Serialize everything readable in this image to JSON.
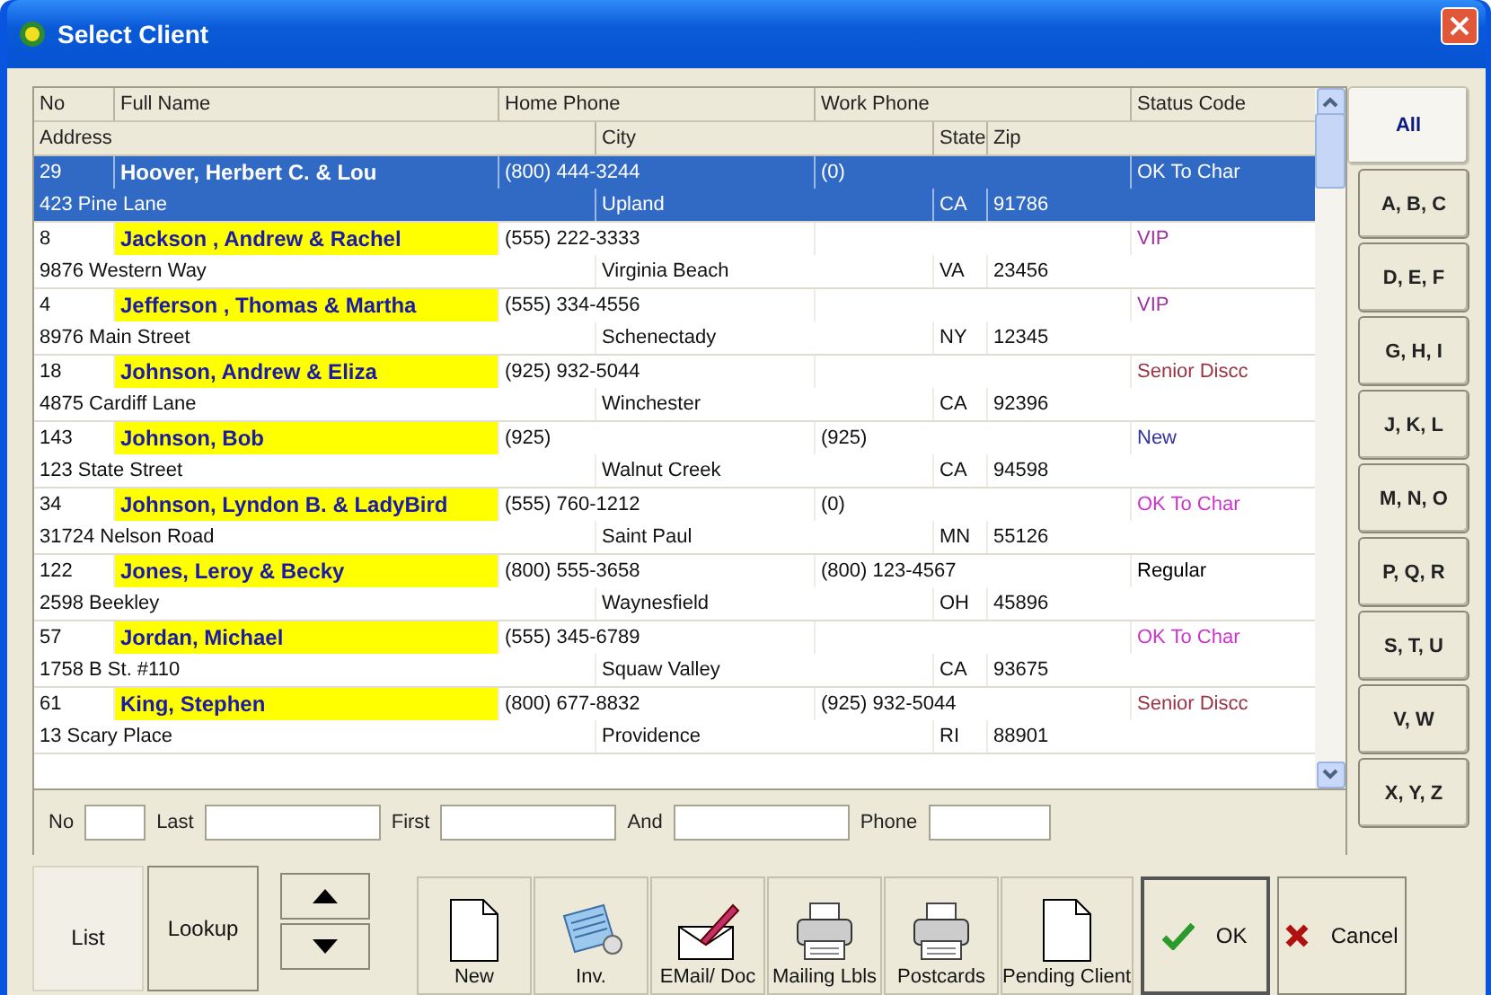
{
  "window": {
    "title": "Select Client"
  },
  "table": {
    "columns_line1": [
      "No",
      "Full Name",
      "Home Phone",
      "Work Phone",
      "Status Code"
    ],
    "columns_line2": [
      "Address",
      "City",
      "State",
      "Zip"
    ],
    "rows": [
      {
        "no": "29",
        "name": "Hoover, Herbert C. & Lou",
        "home_phone": "(800) 444-3244",
        "work_phone": "(0)",
        "status": "OK  To Char",
        "address": "423 Pine Lane",
        "city": "Upland",
        "state": "CA",
        "zip": "91786",
        "selected": true
      },
      {
        "no": "8",
        "name": "Jackson , Andrew & Rachel",
        "home_phone": "(555) 222-3333",
        "status": "VIP",
        "color": "#a030a0",
        "address": "9876 Western Way",
        "city": "Virginia Beach",
        "state": "VA",
        "zip": "23456",
        "selected": false
      },
      {
        "no": "4",
        "name": "Jefferson , Thomas & Martha",
        "home_phone": "(555) 334-4556",
        "status": "VIP",
        "color": "#a030a0",
        "address": "8976 Main Street",
        "city": "Schenectady",
        "state": "NY",
        "zip": "12345",
        "selected": false
      },
      {
        "no": "18",
        "name": "Johnson, Andrew & Eliza",
        "home_phone": "(925) 932-5044",
        "status": "Senior Discc",
        "color": "#993344",
        "address": "4875 Cardiff Lane",
        "city": "Winchester",
        "state": "CA",
        "zip": "92396",
        "selected": false
      },
      {
        "no": "143",
        "name": "Johnson, Bob",
        "home_phone": "(925)",
        "work_phone": "(925)",
        "status": "New",
        "color": "#333399",
        "address": "123 State Street",
        "city": "Walnut Creek",
        "state": "CA",
        "zip": "94598",
        "selected": false
      },
      {
        "no": "34",
        "name": "Johnson, Lyndon B. & LadyBird",
        "home_phone": "(555) 760-1212",
        "work_phone": "(0)",
        "status": "OK  To Char",
        "color": "#cc33cc",
        "address": "31724 Nelson Road",
        "city": "Saint Paul",
        "state": "MN",
        "zip": "55126",
        "selected": false
      },
      {
        "no": "122",
        "name": "Jones, Leroy & Becky",
        "home_phone": "(800) 555-3658",
        "work_phone": "(800) 123-4567",
        "status": "Regular",
        "color": "#000000",
        "address": "2598 Beekley",
        "city": "Waynesfield",
        "state": "OH",
        "zip": "45896",
        "selected": false
      },
      {
        "no": "57",
        "name": "Jordan, Michael",
        "home_phone": "(555) 345-6789",
        "status": "OK  To Char",
        "color": "#cc33cc",
        "address": "1758 B St. #110",
        "city": "Squaw Valley",
        "state": "CA",
        "zip": "93675",
        "selected": false
      },
      {
        "no": "61",
        "name": "King, Stephen",
        "home_phone": "(800) 677-8832",
        "work_phone": "(925) 932-5044",
        "status": "Senior Discc",
        "color": "#993344",
        "address": "13 Scary Place",
        "city": "Providence",
        "state": "RI",
        "zip": "88901",
        "selected": false
      }
    ]
  },
  "search": [
    {
      "label": "No"
    },
    {
      "label": "Last"
    },
    {
      "label": "First"
    },
    {
      "label": "And"
    },
    {
      "label": "Phone"
    }
  ],
  "letter_tabs": [
    {
      "label": "All",
      "selected": true
    },
    {
      "label": "A, B, C",
      "selected": false
    },
    {
      "label": "D, E, F",
      "selected": false
    },
    {
      "label": "G, H, I",
      "selected": false
    },
    {
      "label": "J, K, L",
      "selected": false
    },
    {
      "label": "M, N, O",
      "selected": false
    },
    {
      "label": "P, Q, R",
      "selected": false
    },
    {
      "label": "S, T, U",
      "selected": false
    },
    {
      "label": "V, W",
      "selected": false
    },
    {
      "label": "X, Y, Z",
      "selected": false
    }
  ],
  "view_tabs": [
    {
      "label": "List",
      "selected": true
    },
    {
      "label": "Lookup",
      "selected": false
    }
  ],
  "tools": [
    {
      "label": "New",
      "kind": "document"
    },
    {
      "label": "Inv.",
      "kind": "notepad"
    },
    {
      "label": "EMail/ Doc",
      "kind": "envelope"
    },
    {
      "label": "Mailing Lbls",
      "kind": "printer"
    },
    {
      "label": "Postcards",
      "kind": "printer"
    },
    {
      "label": "Pending Client",
      "kind": "document"
    }
  ],
  "actions": [
    {
      "label": "OK",
      "kind": "ok"
    },
    {
      "label": "Cancel",
      "kind": "cancel"
    }
  ]
}
